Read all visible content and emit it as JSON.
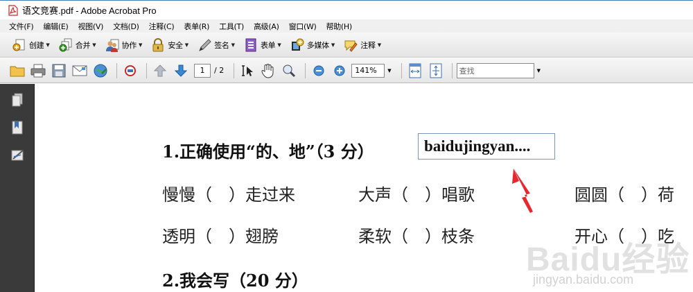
{
  "window": {
    "title": "语文竞赛.pdf - Adobe Acrobat Pro"
  },
  "menu": [
    "文件(F)",
    "编辑(E)",
    "视图(V)",
    "文档(D)",
    "注释(C)",
    "表单(R)",
    "工具(T)",
    "高级(A)",
    "窗口(W)",
    "帮助(H)"
  ],
  "toolbar": {
    "create": "创建",
    "combine": "合并",
    "collaborate": "协作",
    "secure": "安全",
    "sign": "签名",
    "forms": "表单",
    "multimedia": "多媒体",
    "comment": "注释"
  },
  "nav": {
    "current_page": "1",
    "total_pages": "/ 2",
    "zoom": "141%",
    "search_placeholder": "查找"
  },
  "document": {
    "q1": "1.正确使用“的、地”（3 分）",
    "field_value": "baidujingyan....",
    "row1": [
      "慢慢（　）走过来",
      "大声（　）唱歌",
      "圆圆（　）荷"
    ],
    "row2": [
      "透明（　）翅膀",
      "柔软（　）枝条",
      "开心（　）吃"
    ],
    "q2": "2.我会写（20 分）"
  },
  "watermark": {
    "brand": "Baidu经验",
    "url": "jingyan.baidu.com"
  },
  "colors": {
    "accent_red": "#e8262d",
    "field_border": "#7c95b8",
    "panel": "#3a3a3a"
  }
}
